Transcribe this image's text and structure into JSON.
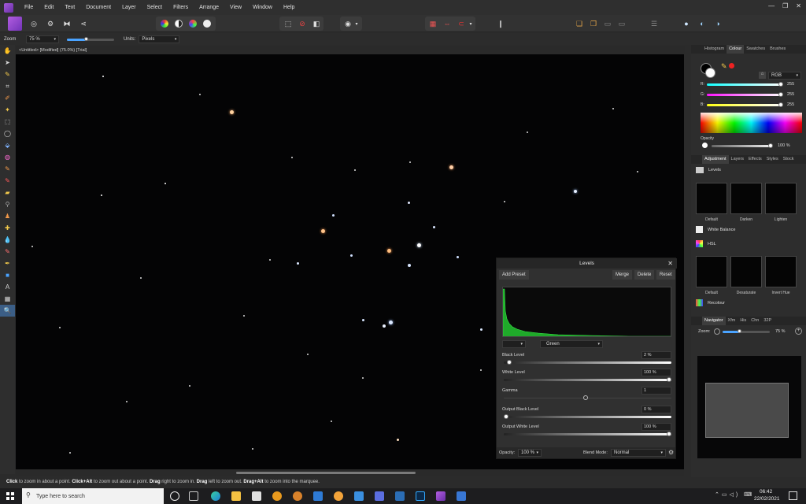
{
  "menu": [
    "File",
    "Edit",
    "Text",
    "Document",
    "Layer",
    "Select",
    "Filters",
    "Arrange",
    "View",
    "Window",
    "Help"
  ],
  "window_controls": [
    "—",
    "❐",
    "✕"
  ],
  "context": {
    "zoom_label": "Zoom",
    "zoom_value": "75 %",
    "zoom_fraction": 0.4,
    "units_label": "Units:",
    "units_value": "Pixels"
  },
  "document_tab": "<Untitled> [Modified] (75.0%) [Trial]",
  "status": {
    "b1": "Click",
    "t1": " to zoom in about a point. ",
    "b2": "Click+Alt",
    "t2": " to zoom out about a point. ",
    "b3": "Drag",
    "t3": " right to zoom in. ",
    "b4": "Drag",
    "t4": " left to zoom out. ",
    "b5": "Drag+Alt",
    "t5": " to zoom into the marquee."
  },
  "colour_panel": {
    "tabs": [
      "Histogram",
      "Colour",
      "Swatches",
      "Brushes"
    ],
    "active": "Colour",
    "mode": "RGB",
    "r_label": "R:",
    "r_value": "255",
    "g_label": "G:",
    "g_value": "255",
    "b_label": "B:",
    "b_value": "255",
    "opacity_label": "Opacity",
    "opacity_value": "100 %"
  },
  "adjustment_panel": {
    "tabs": [
      "Adjustment",
      "Layers",
      "Effects",
      "Styles",
      "Stock"
    ],
    "active": "Adjustment",
    "levels_label": "Levels",
    "levels_presets": [
      "Default",
      "Darken",
      "Lighten"
    ],
    "white_balance_label": "White Balance",
    "hsl_label": "HSL",
    "hsl_presets": [
      "Default",
      "Desaturate",
      "Invert Hue"
    ],
    "recolour_label": "Recolour"
  },
  "navigator_panel": {
    "tabs": [
      "Navigator",
      "Xfm",
      "His",
      "Chn",
      "32P"
    ],
    "active": "Navigator",
    "zoom_label": "Zoom:",
    "zoom_value": "75 %"
  },
  "levels_dialog": {
    "title": "Levels",
    "add_preset": "Add Preset",
    "merge": "Merge",
    "delete": "Delete",
    "reset": "Reset",
    "channel": "Green",
    "black_level_label": "Black Level",
    "black_level_value": "2 %",
    "black_level_fraction": 0.02,
    "white_level_label": "White Level",
    "white_level_value": "100 %",
    "white_level_fraction": 1.0,
    "gamma_label": "Gamma",
    "gamma_value": "1",
    "output_black_label": "Output Black Level",
    "output_black_value": "0 %",
    "output_black_fraction": 0.0,
    "output_white_label": "Output White Level",
    "output_white_value": "100 %",
    "output_white_fraction": 1.0,
    "opacity_label": "Opacity:",
    "opacity_value": "100 %",
    "blend_label": "Blend Mode:",
    "blend_value": "Normal"
  },
  "taskbar": {
    "search_placeholder": "Type here to search",
    "time": "06:42",
    "date": "22/02/2021"
  }
}
